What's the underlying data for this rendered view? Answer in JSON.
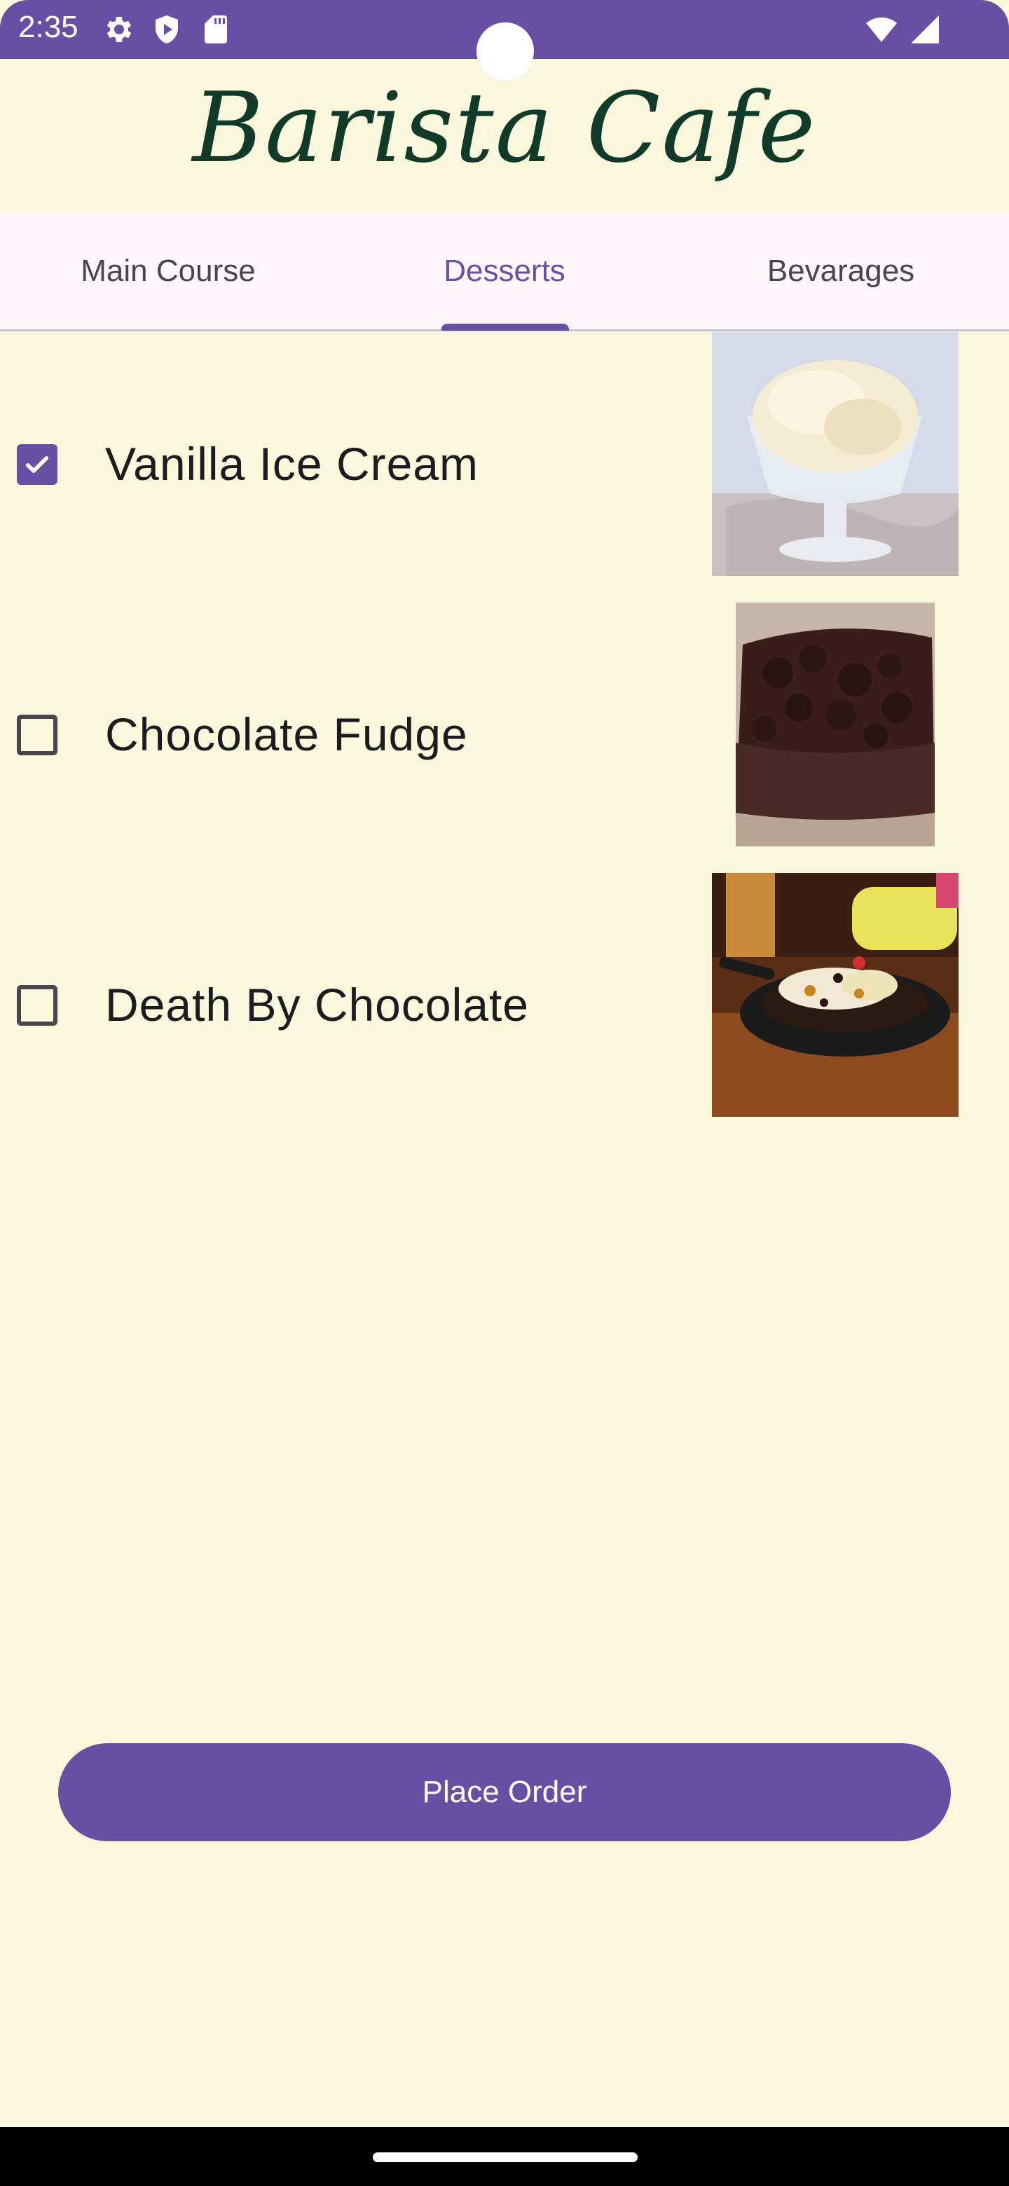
{
  "status_bar": {
    "time": "2:35",
    "icons_left": [
      "gear-icon",
      "shield-play-icon",
      "sd-card-icon"
    ],
    "icons_right": [
      "wifi-icon",
      "signal-icon"
    ],
    "background": "#6750A4"
  },
  "app": {
    "title": "Barista Cafe",
    "title_color": "#123A2A"
  },
  "tabs": [
    {
      "label": "Main Course",
      "active": false
    },
    {
      "label": "Desserts",
      "active": true
    },
    {
      "label": "Bevarages",
      "active": false
    }
  ],
  "items": [
    {
      "label": "Vanilla Ice Cream",
      "checked": true,
      "image": "vanilla-ice-cream-photo"
    },
    {
      "label": "Chocolate Fudge",
      "checked": false,
      "image": "chocolate-fudge-photo"
    },
    {
      "label": "Death By Chocolate",
      "checked": false,
      "image": "death-by-chocolate-photo"
    }
  ],
  "actions": {
    "place_order_label": "Place Order"
  },
  "colors": {
    "accent": "#6750A4",
    "background": "#F9F8DC",
    "tab_bar": "#FDF7FB"
  }
}
